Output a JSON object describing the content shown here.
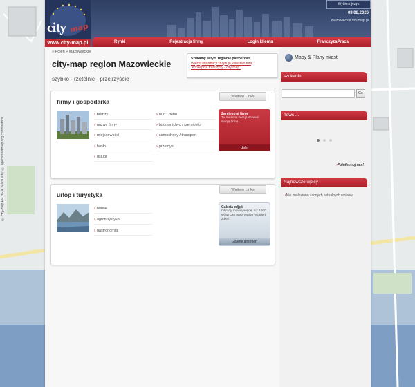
{
  "header": {
    "logo_city": "city",
    "logo_map": "map",
    "logo_url": "www.city-map.pl",
    "language_button": "Wybierz język",
    "date": "03.08.2026",
    "site_name": "mazowieckie.city-map.pl"
  },
  "nav": {
    "items": [
      "Rynki",
      "Rejestracja firmy",
      "Login klienta",
      "FranczyzaPraca"
    ]
  },
  "breadcrumb": "» Polen » Mazowieckie",
  "page": {
    "title": "city-map region Mazowieckie",
    "tagline": "szybko - rzetelnie - przejrzyście"
  },
  "partner_box": {
    "title": "Szukamy w tym regionie partnerów!",
    "link1": "Więcej informacji znajduje Państwo tutaj",
    "link2": "\"koncepcja franczyzy - city-map\""
  },
  "panel_firmy": {
    "title": "firmy i gospodarka",
    "more": "Weitere Links",
    "col1": [
      "branży",
      "nazwy firmy",
      "miejscowości",
      "hasło",
      "usługi"
    ],
    "col2": [
      "hurt / detal",
      "budownictwo / rzemiosło",
      "samochody / transport",
      "przemysł"
    ],
    "promo": {
      "title": "Zarejestruj firmę",
      "text": "Tu możesz zarejestrować swoją firmę...",
      "button": "dalej"
    }
  },
  "panel_urlop": {
    "title": "urlop i turystyka",
    "more": "Weitere Links",
    "col1": [
      "hotele",
      "agroturystyka",
      "gastronomia"
    ],
    "gallery": {
      "title": "Galeria zdjęć",
      "text": "Obrazy mówią więcej niż 1000 słów! Oto nasz region w galerii zdjęć.",
      "button": "Galerie ansehen"
    }
  },
  "sidebar": {
    "maps_label": "Mapy & Plany miast",
    "search_head": "szukanie",
    "go_button": "Go",
    "news_head": "news ...",
    "inform": "Poinformuj nas!",
    "latest_head": "Najnowsze wpisy",
    "no_entries": "Nie znaleziono żadnych aktualnych wpisów."
  },
  "copyright": "© city-map RE BEN, Map Data: © openstreetmap.org contributors"
}
